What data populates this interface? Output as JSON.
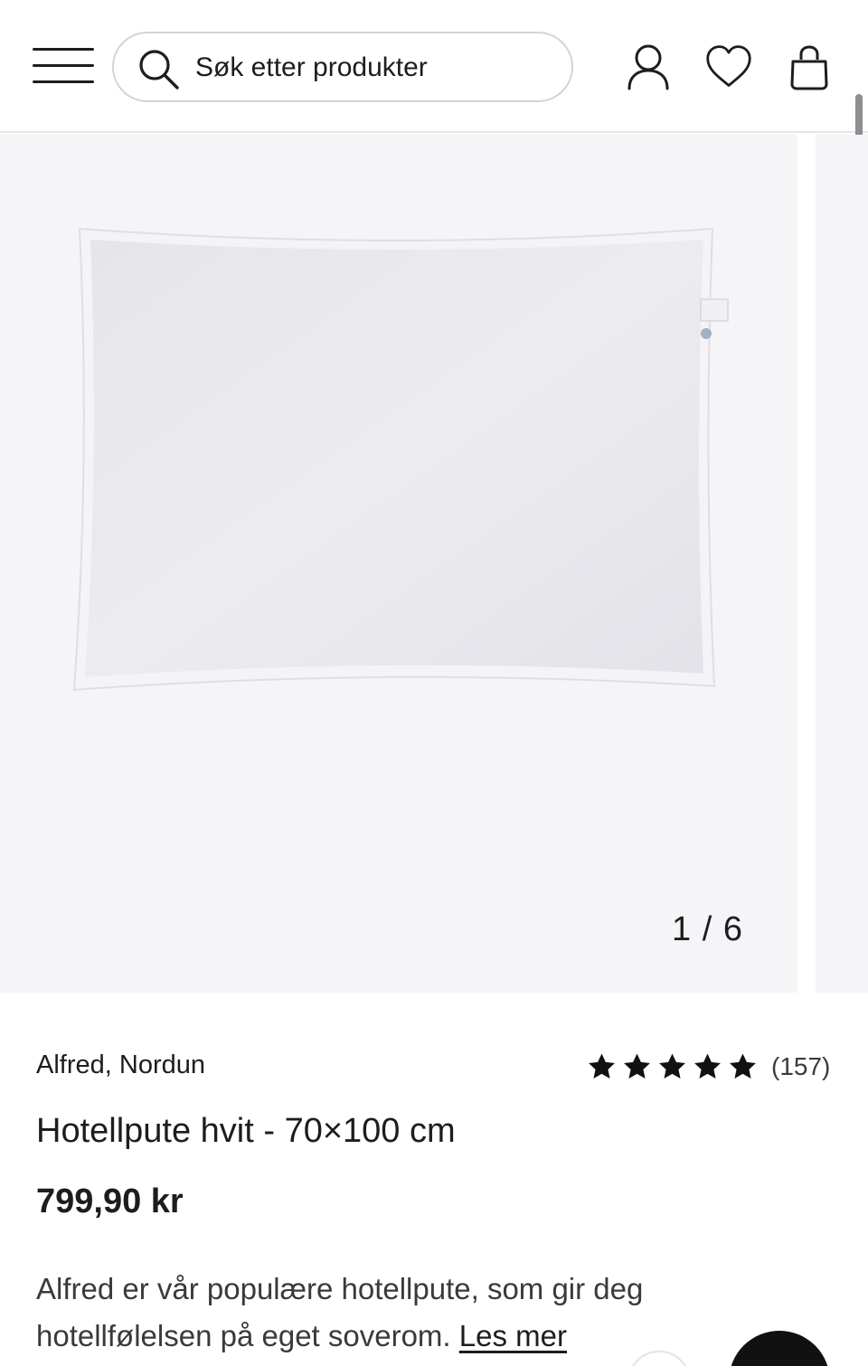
{
  "header": {
    "search_placeholder": "Søk etter produkter",
    "icons": [
      "menu-icon",
      "search-icon",
      "account-icon",
      "heart-icon",
      "shopping-bag-icon"
    ]
  },
  "gallery": {
    "counter": "1 / 6",
    "current": 1,
    "total": 6
  },
  "product": {
    "brand": "Alfred, Nordun",
    "rating_stars": 5,
    "rating_count": "(157)",
    "title": "Hotellpute hvit - 70×100 cm",
    "price": "799,90 kr",
    "description": "Alfred er vår populære hotellpute, som gir deg hotellfølelsen på eget soverom.",
    "read_more": "Les mer"
  },
  "colors": {
    "text": "#1d1d1f",
    "gallery_bg": "#f5f5f7",
    "border": "#d3d3d8"
  }
}
